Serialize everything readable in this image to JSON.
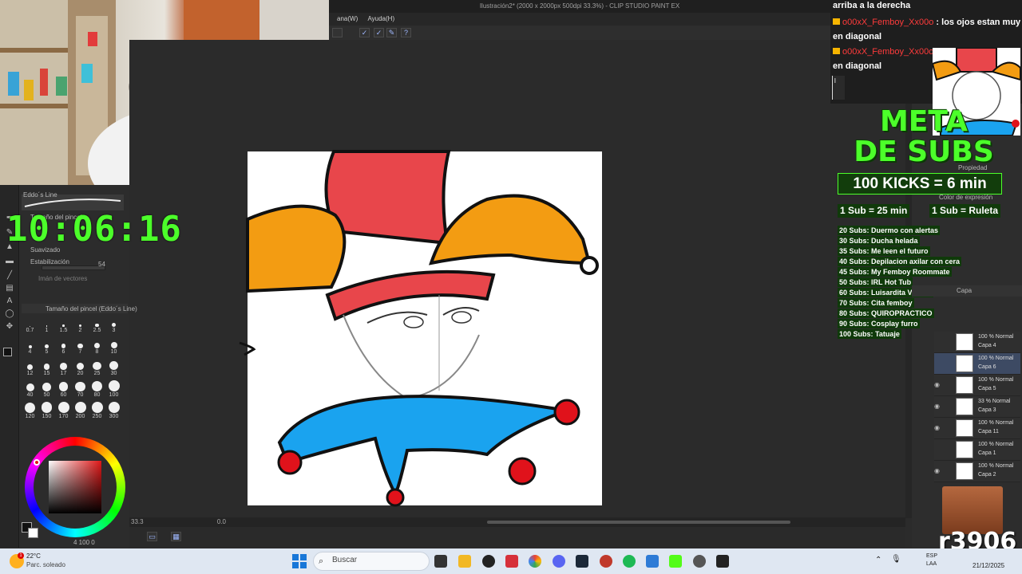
{
  "window": {
    "title": "Ilustración2* (2000 x 2000px 500dpi 33.3%) - CLIP STUDIO PAINT EX",
    "menu": [
      "ana(W)",
      "Ayuda(H)"
    ]
  },
  "timer": "10:06:16",
  "chat": {
    "header": "arriba a la derecha",
    "messages": [
      {
        "user": "o00xX_Femboy_Xx00o",
        "text": "los ojos estan muy en diagonal"
      },
      {
        "user": "o00xX_Femboy_Xx00o",
        "text": "los ojos estan muy en diagonal"
      }
    ],
    "input_value": "l"
  },
  "goals": {
    "title_line1": "META",
    "title_line2": "DE SUBS",
    "kicks": "100 KICKS = 6 min",
    "sub_rule_1": "1 Sub = 25 min",
    "sub_rule_2": "1 Sub = Ruleta",
    "list": [
      "20 Subs: Duermo con alertas",
      "30 Subs: Ducha helada",
      "35 Subs: Me leen el futuro",
      "40 Subs: Depilacion axilar con cera",
      "45 Subs: My Femboy Roommate",
      "50 Subs: IRL Hot Tub",
      "60 Subs: Luisardita VTuber",
      "70 Subs: Cita femboy",
      "80 Subs: QUIROPRACTICO",
      "90 Subs: Cosplay furro",
      "100 Subs: Tatuaje"
    ]
  },
  "tool_property": {
    "brush_name": "Eddo´s Line",
    "size_label": "Tamaño del pincel",
    "smoothing_label": "Suavizado",
    "stabilization_label": "Estabilización",
    "stabilization_value": "54",
    "vector_label": "Imán de vectores",
    "brush_size_panel_title": "Tamaño del pincel (Eddo´s Line)",
    "sizes": [
      "0.7",
      "1",
      "1.5",
      "2",
      "2.5",
      "3",
      "4",
      "5",
      "6",
      "7",
      "8",
      "10",
      "12",
      "15",
      "17",
      "20",
      "25",
      "30",
      "40",
      "50",
      "60",
      "70",
      "80",
      "100",
      "120",
      "150",
      "170",
      "200",
      "250",
      "300"
    ]
  },
  "color": {
    "main": "#111111",
    "sub": "#ffffff",
    "hue": "#e01818",
    "footer": "4 100 0"
  },
  "canvas": {
    "zoom": "33.3",
    "angle": "0.0"
  },
  "right_panel": {
    "property_label": "Propiedad",
    "expression_label": "Color de expresión",
    "layer_tab": "Capa"
  },
  "layers": [
    {
      "mode": "100 % Normal",
      "name": "Capa 4",
      "active": false
    },
    {
      "mode": "100 % Normal",
      "name": "Capa 6",
      "active": true
    },
    {
      "mode": "100 % Normal",
      "name": "Capa 5",
      "active": false
    },
    {
      "mode": "33 % Normal",
      "name": "Capa 3",
      "active": false
    },
    {
      "mode": "100 % Normal",
      "name": "Capa 11",
      "active": false
    },
    {
      "mode": "100 % Normal",
      "name": "Capa 1",
      "active": false
    },
    {
      "mode": "100 % Normal",
      "name": "Capa 2",
      "active": false
    }
  ],
  "watermark": "r3906",
  "taskbar": {
    "weather_temp": "22°C",
    "weather_desc": "Parc. soleado",
    "weather_badge": "1",
    "search_placeholder": "Buscar",
    "lang_line1": "ESP",
    "lang_line2": "LAA",
    "time": "",
    "date": "21/12/2025"
  },
  "colors": {
    "accent_green": "#4cff2a",
    "jester_red": "#e8464b",
    "jester_orange": "#f39c12",
    "jester_blue": "#1aa3ef"
  }
}
